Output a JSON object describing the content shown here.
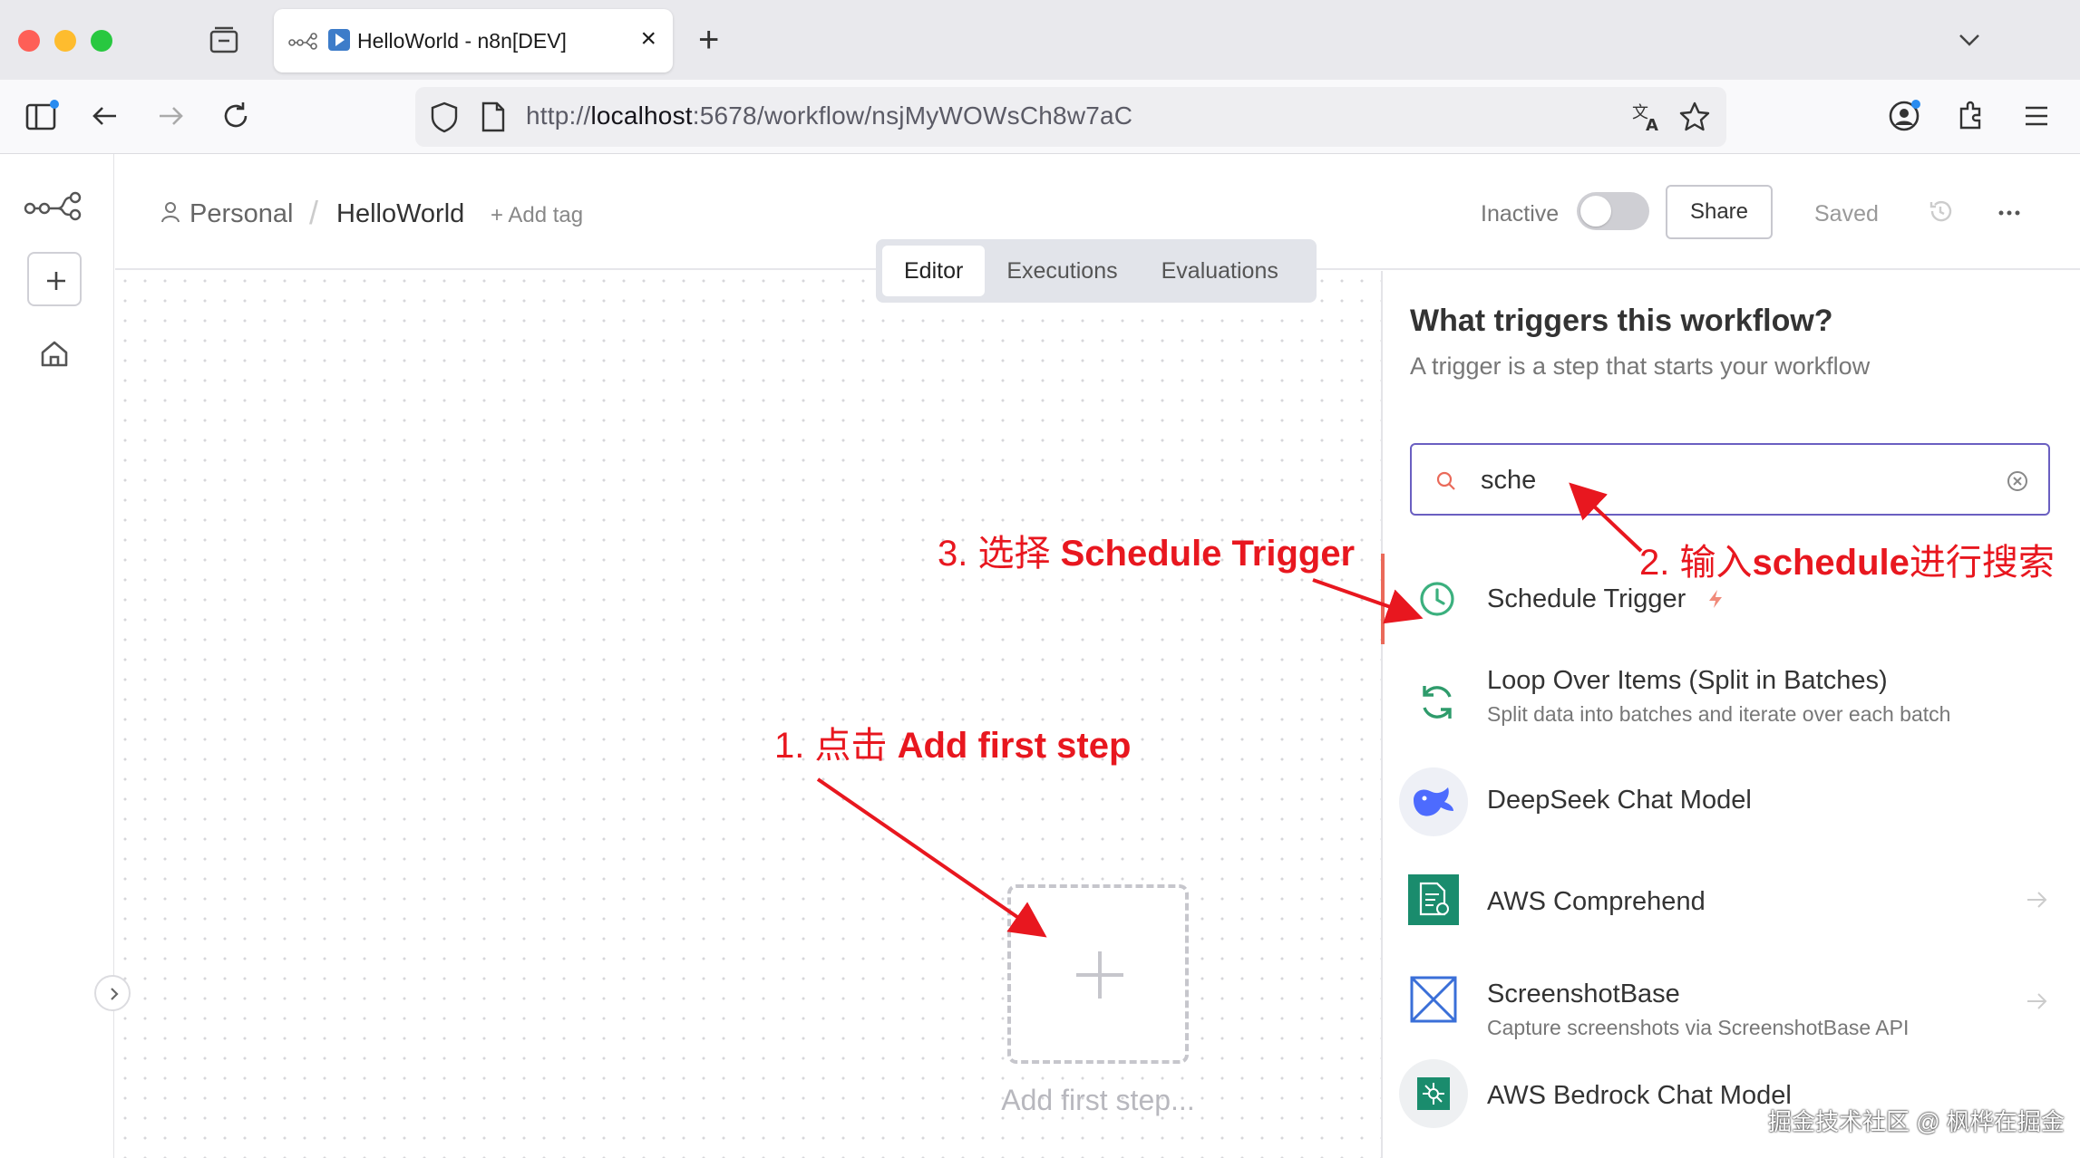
{
  "browser": {
    "tab_title": "HelloWorld - n8n[DEV]",
    "url_prefix": "http://",
    "url_host": "localhost",
    "url_rest": ":5678/workflow/nsjMyWOWsCh8w7aC"
  },
  "header": {
    "breadcrumb_project": "Personal",
    "breadcrumb_separator": "/",
    "workflow_name": "HelloWorld",
    "add_tag_label": "+ Add tag",
    "status_label": "Inactive",
    "share_label": "Share",
    "saved_label": "Saved"
  },
  "view_tabs": [
    {
      "label": "Editor",
      "active": true
    },
    {
      "label": "Executions",
      "active": false
    },
    {
      "label": "Evaluations",
      "active": false
    }
  ],
  "canvas": {
    "add_first_step_label": "Add first step..."
  },
  "panel": {
    "title": "What triggers this workflow?",
    "subtitle": "A trigger is a step that starts your workflow",
    "search_value": "sche",
    "nodes": [
      {
        "name": "Schedule Trigger",
        "description": "",
        "icon": "clock-icon",
        "trigger": true,
        "selected": true
      },
      {
        "name": "Loop Over Items (Split in Batches)",
        "description": "Split data into batches and iterate over each batch",
        "icon": "loop-icon"
      },
      {
        "name": "DeepSeek Chat Model",
        "description": "",
        "icon": "deepseek-whale-icon"
      },
      {
        "name": "AWS Comprehend",
        "description": "",
        "icon": "aws-comprehend-icon",
        "has_arrow": true
      },
      {
        "name": "ScreenshotBase",
        "description": "Capture screenshots via ScreenshotBase API",
        "icon": "screenshotbase-icon",
        "has_arrow": true
      },
      {
        "name": "AWS Bedrock Chat Model",
        "description": "",
        "icon": "aws-bedrock-icon"
      }
    ]
  },
  "annotations": {
    "step1_prefix": "1. 点击 ",
    "step1_bold": "Add first step",
    "step2_prefix": "2. 输入",
    "step2_bold": "schedule",
    "step2_suffix": "进行搜索",
    "step3_prefix": "3. 选择 ",
    "step3_bold": "Schedule Trigger",
    "color": "#e8171f"
  },
  "watermark": "掘金技术社区 @ 枫桦在掘金",
  "colors": {
    "accent": "#6a5fc1",
    "selected_bar": "#ea6a5a",
    "trigger_green": "#3bb07e"
  }
}
